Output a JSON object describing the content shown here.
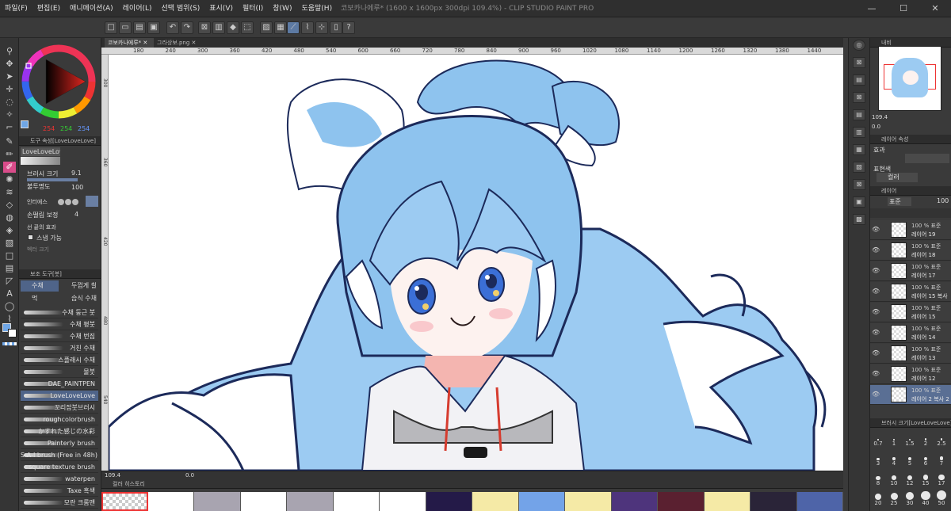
{
  "window": {
    "title": "코보카나에루* (1600 x 1600px 300dpi 109.4%) - CLIP STUDIO PAINT PRO",
    "controls": [
      "—",
      "☐",
      "✕"
    ]
  },
  "menu": [
    "파일(F)",
    "편집(E)",
    "애니메이션(A)",
    "레이어(L)",
    "선택 범위(S)",
    "표시(V)",
    "필터(I)",
    "창(W)",
    "도움말(H)"
  ],
  "doc_tabs": [
    {
      "label": "코보카나에루*",
      "close": "✕"
    },
    {
      "label": "그라상보.png",
      "close": "✕"
    }
  ],
  "ruler_marks": [
    "180",
    "240",
    "300",
    "360",
    "420",
    "480",
    "540",
    "600",
    "660",
    "720",
    "780",
    "840",
    "900",
    "960",
    "1020",
    "1080",
    "1140",
    "1200",
    "1260",
    "1320",
    "1380",
    "1440"
  ],
  "vruler_marks": [
    "300",
    "360",
    "420",
    "480",
    "540"
  ],
  "color_wheel": {
    "values": [
      "254",
      "254",
      "254"
    ],
    "hue_color": "#e0261f"
  },
  "tool_property": {
    "panel_title": "도구 속성[LoveLoveLove]",
    "brush_name": "LoveLoveLove",
    "brush_size_label": "브러시 크기",
    "brush_size_value": "9.1",
    "opacity_label": "불투명도",
    "opacity_value": "100",
    "ink_label": "인터에스",
    "stabilization_label": "손떨림 보정",
    "stabilization_value": "4",
    "line_end_label": "선 끝의 효과",
    "snap_label": "스냅 가능",
    "vector_label": "벡터 크기"
  },
  "subtool": {
    "panel_title": "보조 도구[붓]",
    "tabs": [
      "수채",
      "두껍게 칠",
      "먹",
      "습식 수채"
    ],
    "brushes": [
      "수채 둥근 붓",
      "수채 평붓",
      "수채 번짐",
      "거친 수채",
      "스플래시 수채",
      "물붓",
      "DAE_PAINTPEN",
      "LoveLoveLove",
      "꼬리잡붓브러시",
      "roughcolorbrush",
      "かすれた感じの水彩",
      "Painterly brush",
      "S-A-I brush (Free in 48h)",
      "square texture brush",
      "waterpen",
      "Taxe 혹색",
      "모란 크롬맨"
    ],
    "selected": "LoveLoveLove"
  },
  "status": {
    "zoom": "109.4",
    "angle": "0.0"
  },
  "color_history": {
    "panel_title": "컬러 히스토리",
    "swatches": [
      "transparent",
      "#ffffff",
      "#a8a4b0",
      "#ffffff",
      "#a8a4b0",
      "#ffffff",
      "#ffffff",
      "#241a48",
      "#f5eaa6",
      "#73a3e8",
      "#f5eaa6",
      "#4e347c",
      "#5a2030",
      "#f5eaa6",
      "#2a2438",
      "#4e64a8"
    ]
  },
  "navigator": {
    "panel_title": "내비",
    "zoom": "109.4",
    "angle": "0.0"
  },
  "layer_property": {
    "panel_title": "레이어 속성",
    "effect_label": "효과",
    "expression_label": "표현색",
    "expression_value": "컬러"
  },
  "layers_panel": {
    "panel_title": "레이어",
    "blend_mode": "표준",
    "opacity": "100",
    "layers": [
      {
        "opacity": "100 % 표준",
        "name": "레이어 19"
      },
      {
        "opacity": "100 % 표준",
        "name": "레이어 18"
      },
      {
        "opacity": "100 % 표준",
        "name": "레이어 17"
      },
      {
        "opacity": "100 % 표준",
        "name": "레이어 15 복사"
      },
      {
        "opacity": "100 % 표준",
        "name": "레이어 15"
      },
      {
        "opacity": "100 % 표준",
        "name": "레이어 14"
      },
      {
        "opacity": "100 % 표준",
        "name": "레이어 13"
      },
      {
        "opacity": "100 % 표준",
        "name": "레이어 12"
      },
      {
        "opacity": "100 % 표준",
        "name": "레이어 2 복사 2"
      }
    ]
  },
  "brush_size_panel": {
    "panel_title": "브러시 크기[LoveLoveLove]",
    "sizes": [
      "0.7",
      "1",
      "1.5",
      "2",
      "2.5",
      "3",
      "4",
      "5",
      "6",
      "7",
      "8",
      "10",
      "12",
      "15",
      "17",
      "20",
      "25",
      "30",
      "40",
      "50"
    ]
  },
  "colors": {
    "accent": "#5a6f94",
    "active_tool": "#d94c8a",
    "hair": "#8ec3ee",
    "outline": "#1c2a5a"
  }
}
